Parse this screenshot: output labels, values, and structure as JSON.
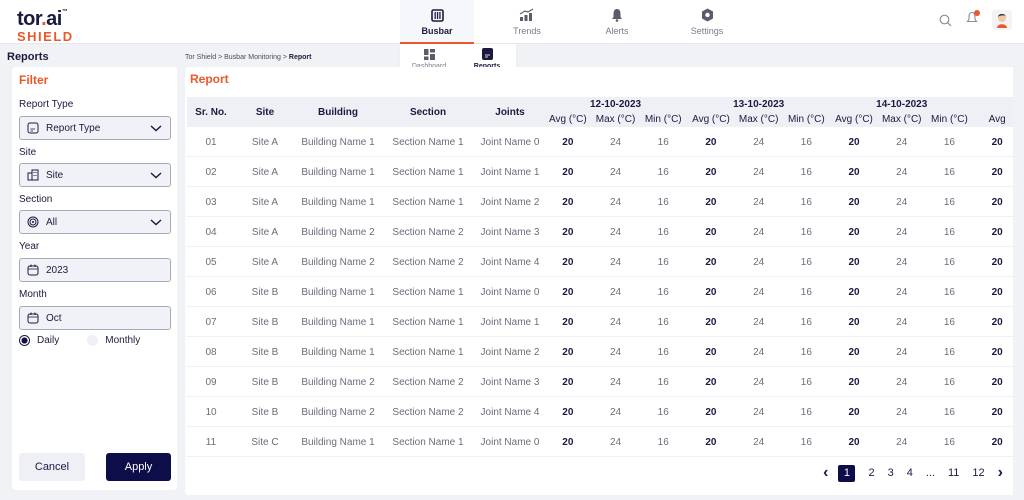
{
  "brand": {
    "name_prefix": "tor",
    "name_dot": ".",
    "name_suffix": "ai",
    "tm": "™",
    "product": "SHIELD"
  },
  "colors": {
    "accent": "#e85a2c",
    "primary": "#0d0d4a",
    "surface": "#f1f2f6"
  },
  "nav": [
    {
      "label": "Busbar",
      "icon": "busbar-icon",
      "active": true
    },
    {
      "label": "Trends",
      "icon": "trends-icon",
      "active": false
    },
    {
      "label": "Alerts",
      "icon": "bell-icon",
      "active": false
    },
    {
      "label": "Settings",
      "icon": "gear-icon",
      "active": false
    }
  ],
  "subnav": [
    {
      "label": "Dashboard",
      "icon": "dashboard-icon",
      "active": false
    },
    {
      "label": "Reports",
      "icon": "report-icon",
      "active": true
    }
  ],
  "page_title": "Reports",
  "breadcrumb": {
    "parts": [
      "Tor Shield",
      "Busbar Monitoring"
    ],
    "current": "Report",
    "sep": " > "
  },
  "filter": {
    "title": "Filter",
    "report_type": {
      "label": "Report Type",
      "value": "Report Type"
    },
    "site": {
      "label": "Site",
      "value": "Site"
    },
    "section": {
      "label": "Section",
      "value": "All"
    },
    "year": {
      "label": "Year",
      "value": "2023"
    },
    "month": {
      "label": "Month",
      "value": "Oct"
    },
    "mode_options": [
      {
        "label": "Daily",
        "selected": true
      },
      {
        "label": "Monthly",
        "selected": false
      }
    ],
    "cancel": "Cancel",
    "apply": "Apply"
  },
  "report": {
    "title": "Report",
    "columns": [
      "Sr. No.",
      "Site",
      "Building",
      "Section",
      "Joints"
    ],
    "dates": [
      "12-10-2023",
      "13-10-2023",
      "14-10-2023"
    ],
    "sub_columns": [
      "Avg (°C)",
      "Max (°C)",
      "Min (°C)"
    ],
    "partial_col": "Avg",
    "rows": [
      {
        "sr": "01",
        "site": "Site A",
        "building": "Building Name 1",
        "section": "Section Name 1",
        "joint": "Joint Name 0",
        "avg": "20",
        "max": "24",
        "min": "16"
      },
      {
        "sr": "02",
        "site": "Site A",
        "building": "Building Name 1",
        "section": "Section Name 1",
        "joint": "Joint Name 1",
        "avg": "20",
        "max": "24",
        "min": "16"
      },
      {
        "sr": "03",
        "site": "Site A",
        "building": "Building Name 1",
        "section": "Section Name 1",
        "joint": "Joint Name 2",
        "avg": "20",
        "max": "24",
        "min": "16"
      },
      {
        "sr": "04",
        "site": "Site A",
        "building": "Building Name 2",
        "section": "Section Name 2",
        "joint": "Joint Name 3",
        "avg": "20",
        "max": "24",
        "min": "16"
      },
      {
        "sr": "05",
        "site": "Site A",
        "building": "Building Name 2",
        "section": "Section Name 2",
        "joint": "Joint Name 4",
        "avg": "20",
        "max": "24",
        "min": "16"
      },
      {
        "sr": "06",
        "site": "Site B",
        "building": "Building Name 1",
        "section": "Section Name 1",
        "joint": "Joint Name 0",
        "avg": "20",
        "max": "24",
        "min": "16"
      },
      {
        "sr": "07",
        "site": "Site B",
        "building": "Building Name 1",
        "section": "Section Name 1",
        "joint": "Joint Name 1",
        "avg": "20",
        "max": "24",
        "min": "16"
      },
      {
        "sr": "08",
        "site": "Site B",
        "building": "Building Name 1",
        "section": "Section Name 1",
        "joint": "Joint Name 2",
        "avg": "20",
        "max": "24",
        "min": "16"
      },
      {
        "sr": "09",
        "site": "Site B",
        "building": "Building Name 2",
        "section": "Section Name 2",
        "joint": "Joint Name 3",
        "avg": "20",
        "max": "24",
        "min": "16"
      },
      {
        "sr": "10",
        "site": "Site B",
        "building": "Building Name 2",
        "section": "Section Name 2",
        "joint": "Joint Name 4",
        "avg": "20",
        "max": "24",
        "min": "16"
      },
      {
        "sr": "11",
        "site": "Site C",
        "building": "Building Name 1",
        "section": "Section Name 1",
        "joint": "Joint Name 0",
        "avg": "20",
        "max": "24",
        "min": "16"
      }
    ]
  },
  "pagination": {
    "prev": "‹",
    "next": "›",
    "pages": [
      "1",
      "2",
      "3",
      "4",
      "...",
      "11",
      "12"
    ],
    "current": "1"
  }
}
